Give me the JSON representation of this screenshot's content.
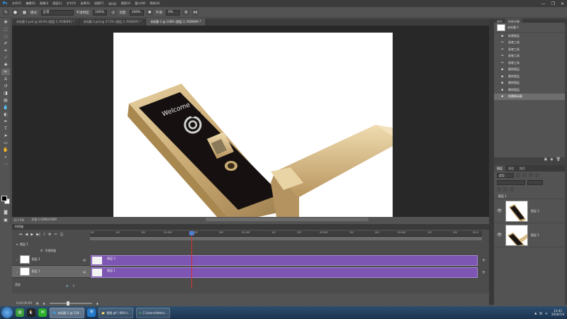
{
  "app": {
    "logo": "Ps"
  },
  "menu": [
    "文件(F)",
    "编辑(E)",
    "图像(I)",
    "图层(L)",
    "文字(Y)",
    "选择(S)",
    "滤镜(T)",
    "3D(D)",
    "视图(V)",
    "窗口(W)",
    "帮助(H)"
  ],
  "window_controls": {
    "minimize": "—",
    "restore": "❐",
    "close": "✕"
  },
  "options": {
    "mode_label": "模式:",
    "mode_value": "正常",
    "opacity_label": "不透明度:",
    "opacity_value": "100%",
    "flow_label": "流量:",
    "flow_value": "100%",
    "smooth_label": "平滑:",
    "smooth_value": "0%"
  },
  "doc_tabs": [
    {
      "label": "未标题-1.psd @ 26.6% (图层 2, RGB/8#) *",
      "active": false
    },
    {
      "label": "未标题-1.psd @ 37.5% (图层 2, RGB/8#) *",
      "active": false
    },
    {
      "label": "未标题-1 @ 118% (图层 2, RGB/8#) *",
      "active": true
    }
  ],
  "canvas_art": {
    "welcome_text": "Welcome"
  },
  "status": {
    "zoom": "117.5%",
    "doc_size": "文档:1.03M/4.60M"
  },
  "history": {
    "tabs": [
      "属性",
      "历史记录"
    ],
    "snapshot_label": "未标题-1",
    "items": [
      {
        "label": "新建图层",
        "selected": false
      },
      {
        "label": "画笔工具",
        "selected": false
      },
      {
        "label": "画笔工具",
        "selected": false
      },
      {
        "label": "画笔工具",
        "selected": false
      },
      {
        "label": "画笔工具",
        "selected": false
      },
      {
        "label": "删除图层",
        "selected": false
      },
      {
        "label": "删除图层",
        "selected": false
      },
      {
        "label": "删除图层",
        "selected": false
      },
      {
        "label": "删除图层",
        "selected": false
      },
      {
        "label": "创建帧动画",
        "selected": true
      }
    ]
  },
  "layers": {
    "tabs": [
      "图层",
      "通道",
      "路径"
    ],
    "kind_label": "类型",
    "group_label": "图层 1",
    "items": [
      {
        "name": "图层 3",
        "selected": false
      },
      {
        "name": "图层 1",
        "selected": false
      }
    ]
  },
  "timeline": {
    "title": "时间轴",
    "ruler": [
      "00",
      "10f",
      "20f",
      "01:00f",
      "10f",
      "20f",
      "02:00f",
      "10f",
      "20f",
      "03:00f",
      "10f",
      "20f",
      "04:00f",
      "10f",
      "20f",
      "05:0"
    ],
    "rows": [
      {
        "label": "图层 1",
        "type": "group"
      },
      {
        "label": "不透明度",
        "type": "prop"
      },
      {
        "label": "图层 3",
        "type": "layer"
      },
      {
        "label": "图层 1",
        "type": "layer"
      }
    ],
    "clips": [
      "图层 3",
      "图层 1"
    ],
    "audio_label": "音轨",
    "timecode": "0:00:00:09"
  },
  "taskbar": {
    "apps": [
      {
        "label": "未标题-1 @ 118...",
        "active": true
      },
      {
        "label": "视频 gif / 600 h...",
        "active": false
      },
      {
        "label": "C:\\Users\\Admin...",
        "active": false
      }
    ],
    "clock_time": "13:43",
    "clock_date": "2019/7/4"
  }
}
